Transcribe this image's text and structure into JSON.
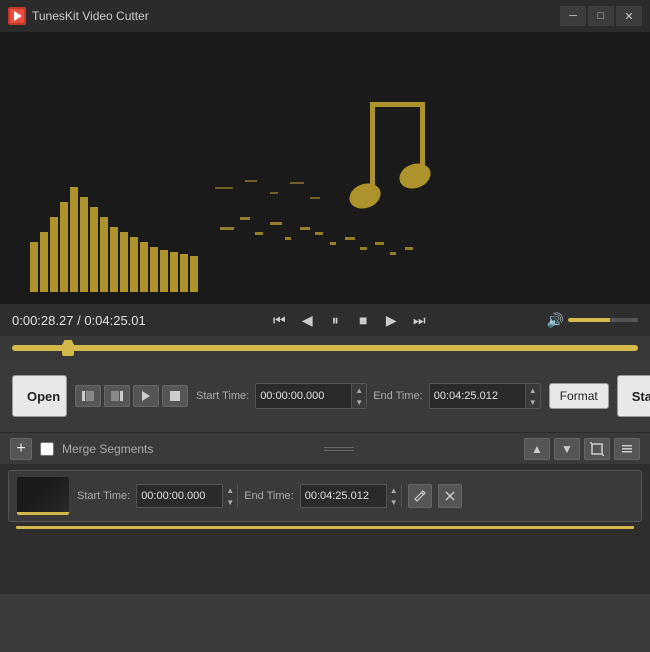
{
  "titleBar": {
    "appName": "TunesKit Video Cutter",
    "minimizeLabel": "─",
    "maximizeLabel": "□",
    "closeLabel": "✕"
  },
  "timeBar": {
    "currentTime": "0:00:28.27",
    "totalTime": "0:04:25.01",
    "separator": "/"
  },
  "playbackControls": {
    "skipBack": "⏮",
    "stepBack": "◀",
    "pause": "⏸",
    "stop": "■",
    "play": "▶",
    "skipForward": "⏭"
  },
  "controls": {
    "openLabel": "Open",
    "startLabel": "Start",
    "formatLabel": "Format",
    "startTimeLabel": "Start Time:",
    "endTimeLabel": "End Time:",
    "startTimeValue": "00:00:00.000",
    "endTimeValue": "00:04:25.012"
  },
  "segments": {
    "mergeLabel": "Merge Segments",
    "segStartTimeLabel": "Start Time:",
    "segEndTimeLabel": "End Time:",
    "segStartTimeValue": "00:00:00.000",
    "segEndTimeValue": "00:04:25.012"
  }
}
